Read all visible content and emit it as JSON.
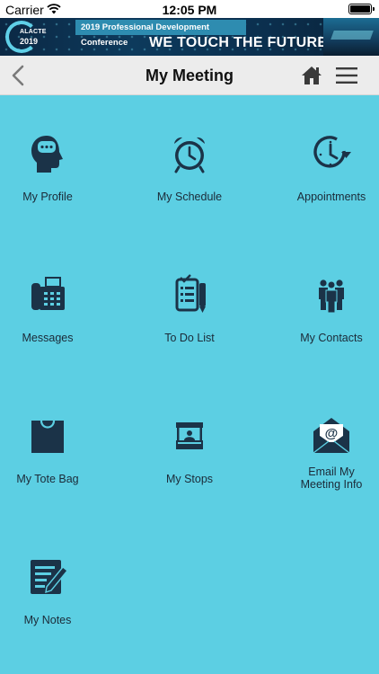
{
  "status_bar": {
    "carrier": "Carrier",
    "time": "12:05 PM"
  },
  "banner": {
    "logo_name": "ALACTE",
    "logo_year": "2019",
    "conference": "2019 Professional Development Conference",
    "headline": "WE TOUCH THE FUTURE"
  },
  "navbar": {
    "title": "My Meeting"
  },
  "colors": {
    "background": "#5ccfe3",
    "icon": "#1b3348",
    "navbar": "#ececec"
  },
  "menu": [
    {
      "label": "My Profile",
      "icon": "head-chat-icon"
    },
    {
      "label": "My Schedule",
      "icon": "alarm-clock-icon"
    },
    {
      "label": "Appointments",
      "icon": "clock-arrow-icon"
    },
    {
      "label": "Messages",
      "icon": "fax-phone-icon"
    },
    {
      "label": "To Do List",
      "icon": "checklist-icon"
    },
    {
      "label": "My Contacts",
      "icon": "people-group-icon"
    },
    {
      "label": "My Tote Bag",
      "icon": "tote-bag-icon"
    },
    {
      "label": "My Stops",
      "icon": "booth-icon"
    },
    {
      "label": "Email My Meeting Info",
      "icon": "email-envelope-icon"
    },
    {
      "label": "My Notes",
      "icon": "notes-pencil-icon"
    }
  ]
}
